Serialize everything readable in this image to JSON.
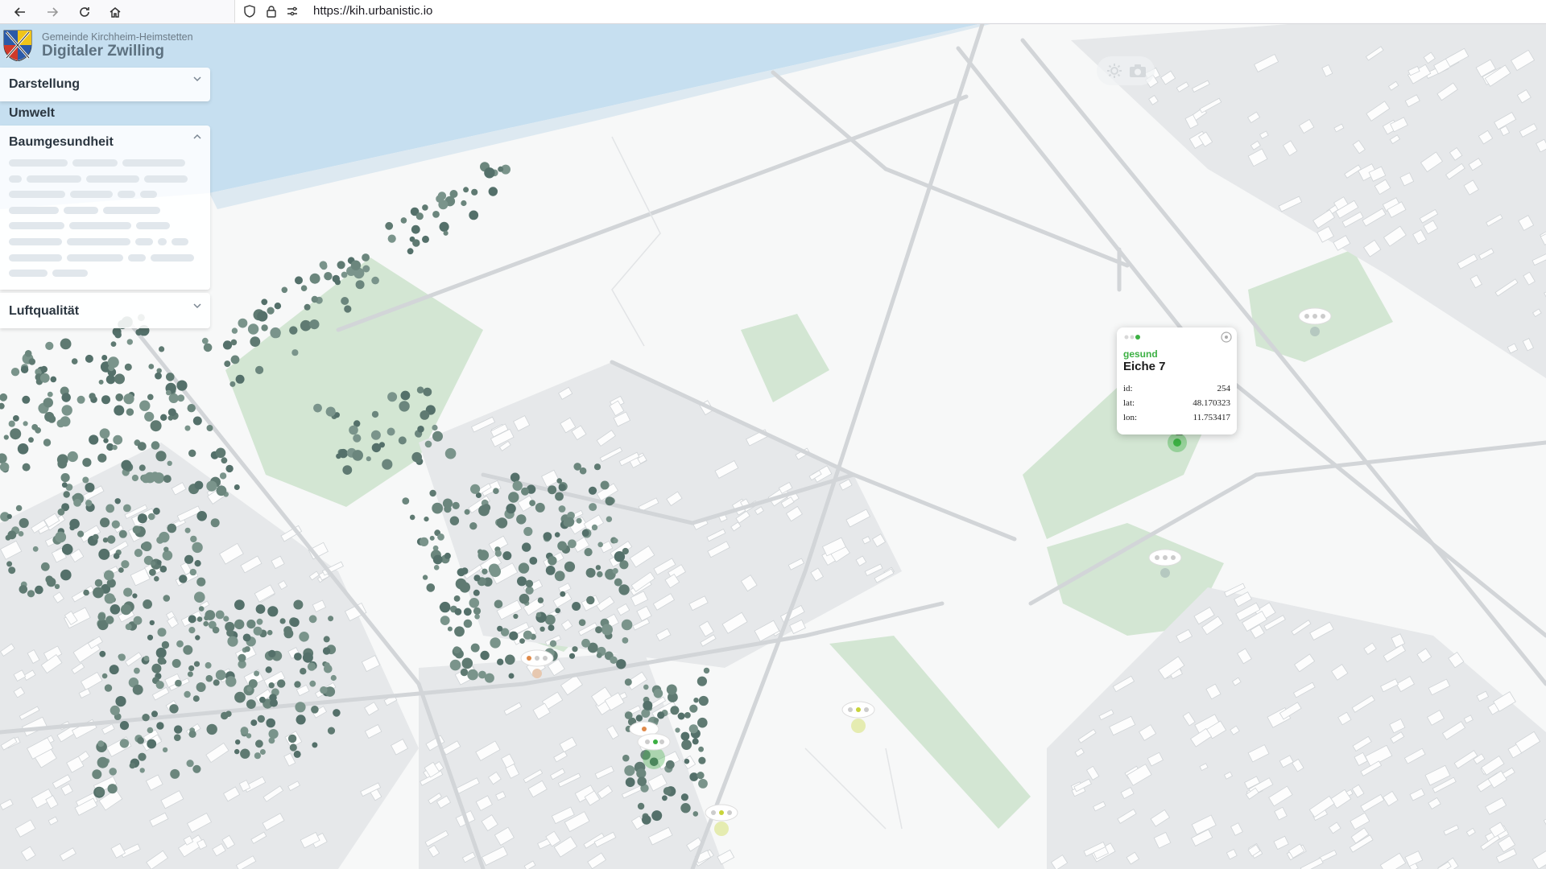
{
  "browser": {
    "url": "https://kih.urbanistic.io",
    "icons": [
      "back-icon",
      "forward-icon",
      "reload-icon",
      "home-icon",
      "shield-icon",
      "lock-icon",
      "permissions-icon"
    ]
  },
  "header": {
    "municipality": "Gemeinde Kirchheim-Heimstetten",
    "title": "Digitaler Zwilling"
  },
  "sidebar": {
    "darstellung": "Darstellung",
    "umwelt": "Umwelt",
    "baumgesundheit": "Baumgesundheit",
    "luftqualitaet": "Luftqualität"
  },
  "popup": {
    "status": "gesund",
    "name": "Eiche 7",
    "rows": [
      {
        "key": "id:",
        "value": "254"
      },
      {
        "key": "lat:",
        "value": "48.170323"
      },
      {
        "key": "lon:",
        "value": "11.753417"
      }
    ]
  },
  "colors": {
    "healthy": "#3cb043",
    "warning": "#c8d43a",
    "damaged": "#e08a4a",
    "tree": "#5f7a72",
    "park": "#d3e6d3",
    "sky": "#c6dff0"
  }
}
